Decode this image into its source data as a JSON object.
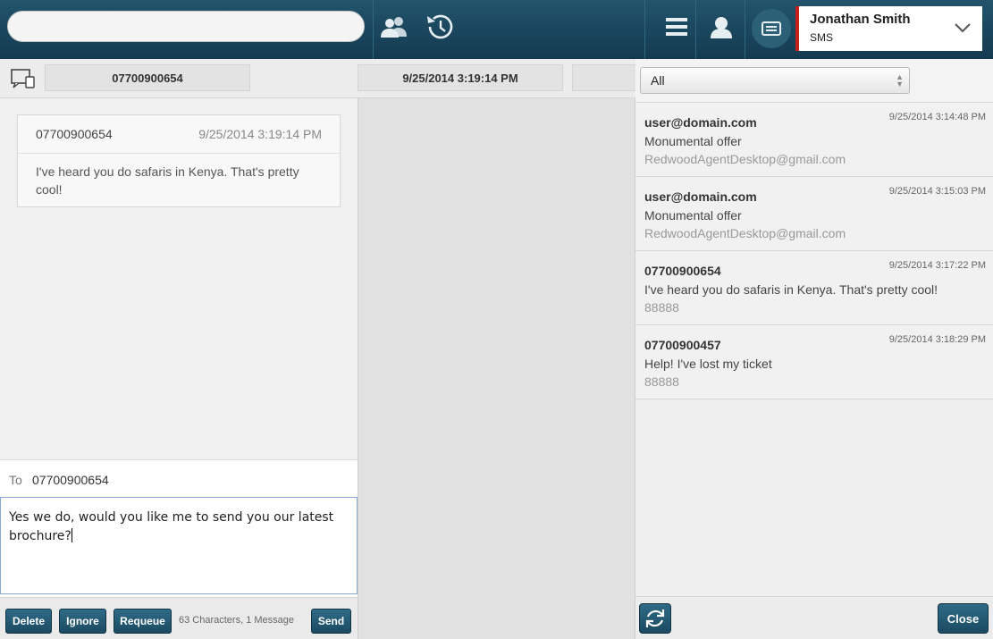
{
  "header": {
    "search_value": "",
    "icons": [
      "contacts-icon",
      "history-icon",
      "menu-icon",
      "agent-icon",
      "sms-device-icon",
      "chevron-down-icon"
    ],
    "agent_name": "Jonathan Smith",
    "agent_channel": "SMS",
    "colors": {
      "bar": "#1a4a62",
      "status": "#c6201b"
    }
  },
  "tabs": {
    "number": "07700900654",
    "datetime": "9/25/2014 3:19:14 PM"
  },
  "conversation": {
    "message": {
      "from": "07700900654",
      "time": "9/25/2014 3:19:14 PM",
      "body": "I've heard you do safaris in Kenya. That's pretty cool!"
    }
  },
  "reply": {
    "to_label": "To",
    "to_value": "07700900654",
    "text": "Yes we do, would you like me to send you our latest brochure?",
    "counter": "63 Characters, 1 Message",
    "buttons": {
      "delete": "Delete",
      "ignore": "Ignore",
      "requeue": "Requeue",
      "send": "Send"
    }
  },
  "inbox": {
    "filter": "All",
    "items": [
      {
        "from": "user@domain.com",
        "time": "9/25/2014 3:14:48 PM",
        "subject": "Monumental offer",
        "to": "RedwoodAgentDesktop@gmail.com"
      },
      {
        "from": "user@domain.com",
        "time": "9/25/2014 3:15:03 PM",
        "subject": "Monumental offer",
        "to": "RedwoodAgentDesktop@gmail.com"
      },
      {
        "from": "07700900654",
        "time": "9/25/2014 3:17:22 PM",
        "subject": "I've heard you do safaris in Kenya. That's pretty cool!",
        "to": "88888"
      },
      {
        "from": "07700900457",
        "time": "9/25/2014 3:18:29 PM",
        "subject": "Help! I've lost my ticket",
        "to": "88888"
      }
    ],
    "close_label": "Close"
  }
}
